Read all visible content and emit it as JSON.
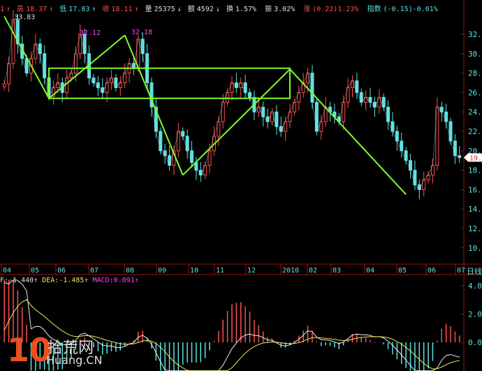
{
  "header": {
    "open_frag": "1",
    "high_label": "高",
    "high": "18.37",
    "low_label": "低",
    "low": "17.83",
    "close_label": "收",
    "close": "18.11",
    "volume_label": "量",
    "volume": "25375",
    "amount_label": "额",
    "amount": "4592",
    "turnover_label": "换",
    "turnover": "1.57%",
    "amplitude_label": "振",
    "amplitude": "3.02%",
    "change_label": "涨",
    "change": "(0.22)1.23%",
    "index_label": "指数",
    "index": "(-0.15)-0.01%"
  },
  "period_label": "日线",
  "current_price_tag": "19.3",
  "macd_legend": {
    "dif": "F:-1.440",
    "dea": "DEA:-1.485",
    "macd": "MACD:0.091"
  },
  "watermark": {
    "number": "10",
    "cn": "拾荒网",
    "en": "Huang.CN"
  },
  "colors": {
    "up": "#ff5050",
    "down": "#5fe0e0",
    "zigzag": "#7cff2a",
    "axis": "#a01010",
    "grid_text": "#5fe0e0"
  },
  "chart_data": [
    {
      "type": "candlestick",
      "title": "",
      "y_ticks": [
        "32.00",
        "30.00",
        "28.00",
        "26.00",
        "24.00",
        "22.00",
        "20.00",
        "18.00",
        "16.00",
        "14.00",
        "12.00",
        "10.00"
      ],
      "ylim": [
        10,
        32
      ],
      "x_ticks": [
        "04",
        "05",
        "06",
        "07",
        "08",
        "09",
        "10",
        "11",
        "12",
        "2010",
        "02",
        "03",
        "04",
        "05",
        "06",
        "07"
      ],
      "annotations": [
        {
          "label": "33.83",
          "price": 33.83
        },
        {
          "label": "32.12",
          "price": 32.12
        },
        {
          "label": "32.18",
          "price": 32.18
        }
      ],
      "closes": [
        26.9,
        29,
        33.5,
        31,
        29.5,
        28,
        29.5,
        31,
        30,
        27.5,
        25.6,
        26.5,
        27,
        26,
        27.5,
        28,
        30,
        32,
        30,
        27.5,
        27,
        26.5,
        26,
        27,
        27.5,
        26.5,
        27,
        28,
        29,
        28.5,
        31.5,
        30,
        27,
        24.5,
        22,
        20,
        19.5,
        18.5,
        20,
        22,
        21.5,
        20,
        18.8,
        18,
        17.5,
        18.5,
        20,
        21.5,
        23,
        25,
        26,
        27,
        26.5,
        27,
        26,
        25.5,
        24,
        24.5,
        23.5,
        23,
        24,
        22.5,
        22,
        23,
        24,
        25,
        26,
        27,
        28,
        25,
        22,
        23,
        24.5,
        24,
        23.5,
        23,
        25,
        26.5,
        27.2,
        26,
        25,
        25.5,
        25,
        24.5,
        25.5,
        24.5,
        23,
        22,
        21,
        20,
        19,
        18,
        16.5,
        16,
        17,
        17.5,
        18.5,
        24.5,
        24,
        23,
        21,
        19.5,
        19.3
      ],
      "zigzag_lines": [
        {
          "from": [
            0,
            33.83
          ],
          "to": [
            10,
            25.4
          ]
        },
        {
          "from": [
            10,
            25.4
          ],
          "to": [
            27,
            31.9
          ]
        },
        {
          "from": [
            27,
            31.9
          ],
          "to": [
            40,
            17.5
          ]
        },
        {
          "from": [
            40,
            17.5
          ],
          "to": [
            64,
            28.4
          ]
        },
        {
          "from": [
            64,
            28.4
          ],
          "to": [
            90,
            15.5
          ]
        }
      ],
      "box": {
        "start": 10,
        "end": 64,
        "top": 28.5,
        "bottom": 25.4
      }
    },
    {
      "type": "macd",
      "y_ticks": [
        "4.0",
        "2.0",
        "0.0"
      ],
      "ylim": [
        -2,
        4.4
      ]
    }
  ]
}
